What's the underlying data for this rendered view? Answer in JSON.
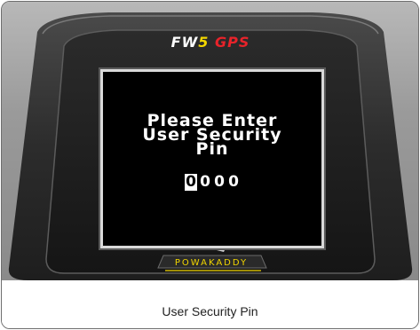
{
  "device": {
    "brand_fw": "FW",
    "brand_model": "5",
    "brand_gps": "GPS",
    "maker": "POWAKADDY",
    "colors": {
      "bezel": "#3a3a3a",
      "screen": "#000000",
      "accent_yellow": "#f2d600",
      "accent_red": "#e8232a"
    }
  },
  "screen": {
    "line1": "Please Enter",
    "line2": "User Security",
    "line3": "Pin",
    "pin_digits": [
      "0",
      "0",
      "0",
      "0"
    ],
    "active_digit_index": 0
  },
  "caption": "User Security Pin",
  "icons": {
    "logo": "powakaddy-logo-icon"
  }
}
